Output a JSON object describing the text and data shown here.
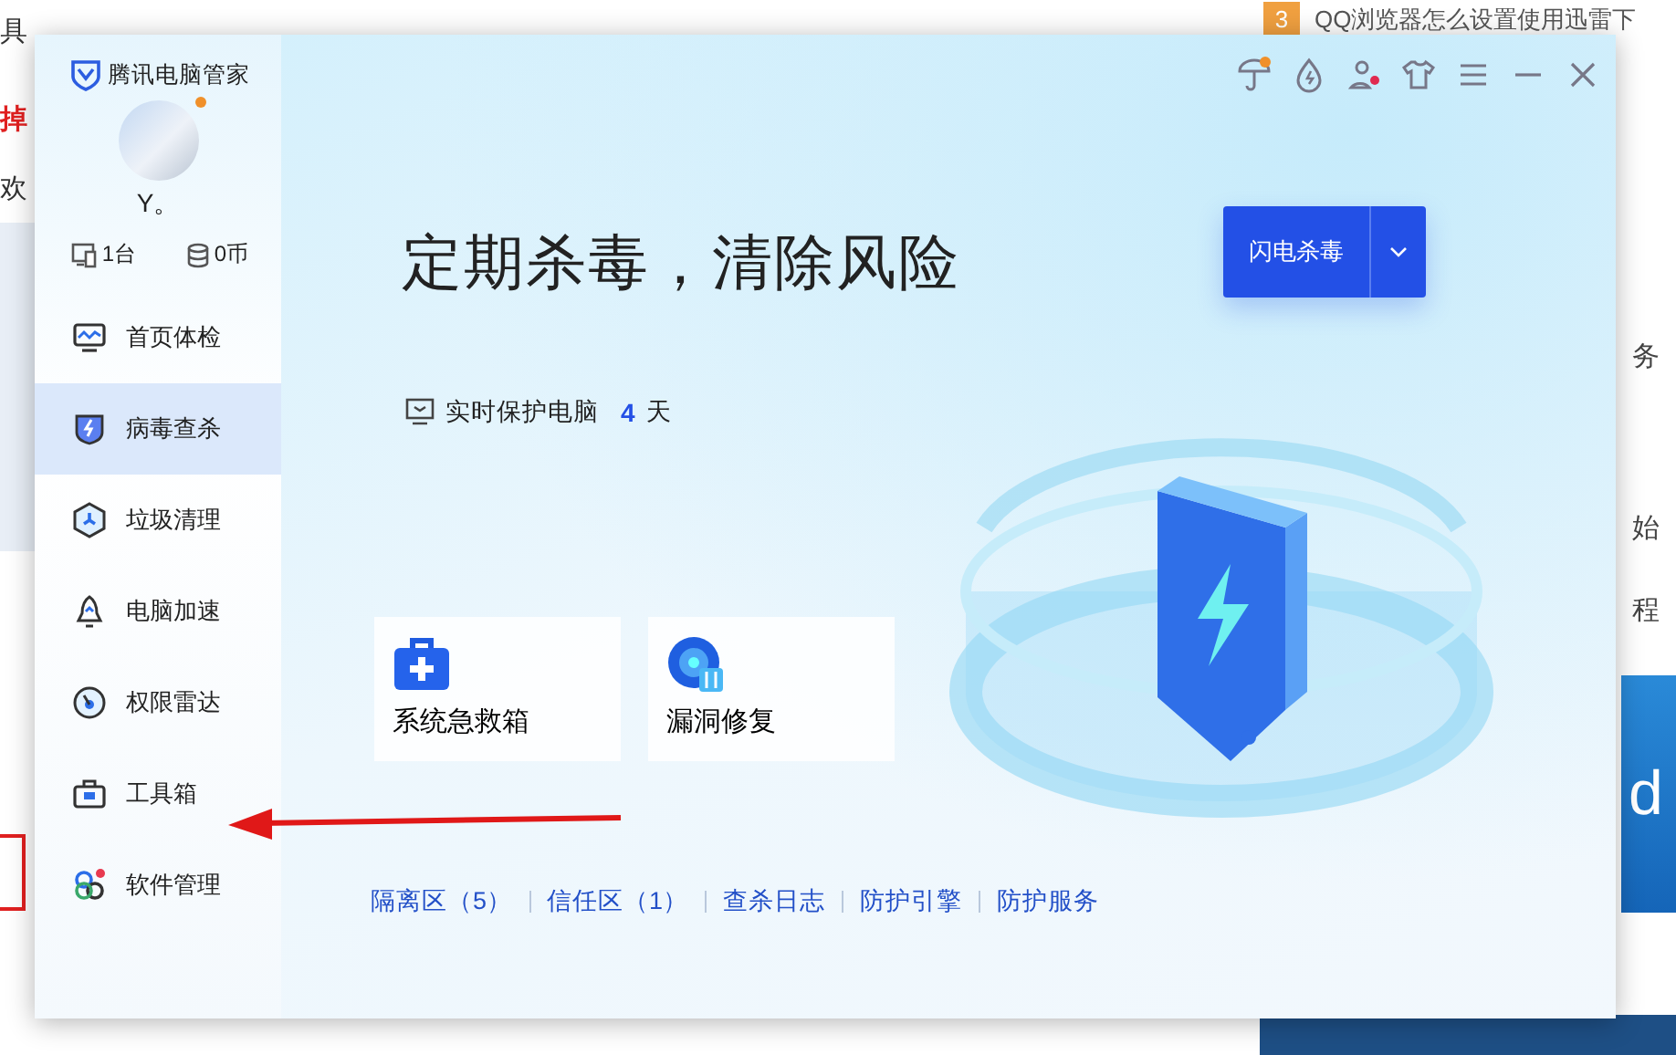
{
  "background_page": {
    "left_texts": [
      {
        "text": "具",
        "kind": "plain"
      },
      {
        "text": "掉",
        "kind": "alert"
      },
      {
        "text": "欢",
        "kind": "plain"
      }
    ],
    "rank_badge": "3",
    "article_title": "QQ浏览器怎么设置使用迅雷下",
    "right_texts": [
      "务",
      "始",
      "程"
    ],
    "banner_text": "d"
  },
  "window": {
    "app_name": "腾讯电脑管家",
    "user_name": "Y。",
    "stats": [
      "1台",
      "0币"
    ],
    "nav": [
      {
        "label": "首页体检",
        "selected": false
      },
      {
        "label": "病毒查杀",
        "selected": true
      },
      {
        "label": "垃圾清理",
        "selected": false
      },
      {
        "label": "电脑加速",
        "selected": false
      },
      {
        "label": "权限雷达",
        "selected": false
      },
      {
        "label": "工具箱",
        "selected": false
      },
      {
        "label": "软件管理",
        "selected": false
      }
    ],
    "headline": "定期杀毒，清除风险",
    "scan_button": "闪电杀毒",
    "protection": {
      "label": "实时保护电脑",
      "days": "4",
      "unit": "天"
    },
    "tools": [
      "系统急救箱",
      "漏洞修复"
    ],
    "links": [
      "隔离区（5）",
      "信任区（1）",
      "查杀日志",
      "防护引擎",
      "防护服务"
    ]
  }
}
